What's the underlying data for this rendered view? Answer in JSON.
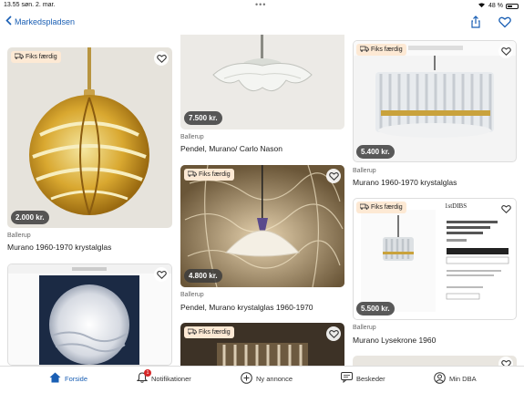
{
  "status": {
    "time": "13.55",
    "date": "søn. 2. mar.",
    "battery": "48 %"
  },
  "nav": {
    "back_label": "Markedspladsen"
  },
  "badge_label": "Fiks færdig",
  "cards": {
    "c1": {
      "price": "2.000 kr.",
      "location": "Ballerup",
      "title": "Murano 1960-1970 krystalglas"
    },
    "c2": {
      "price": "7.500 kr.",
      "location": "Ballerup",
      "title": "Pendel, Murano/ Carlo Nason"
    },
    "c3": {
      "price": "5.400 kr.",
      "location": "Ballerup",
      "title": "Murano 1960-1970 krystalglas"
    },
    "c4": {
      "price": "4.800 kr.",
      "location": "Ballerup",
      "title": "Pendel, Murano krystalglas 1960-1970"
    },
    "c5": {
      "price": "5.500 kr.",
      "location": "Ballerup",
      "title": "Murano Lysekrone 1960"
    }
  },
  "tabs": [
    {
      "label": "Forside"
    },
    {
      "label": "Notifikationer",
      "count": "1"
    },
    {
      "label": "Ny annonce"
    },
    {
      "label": "Beskeder"
    },
    {
      "label": "Min DBA"
    }
  ],
  "colors": {
    "accent": "#1a5fb4",
    "badge_bg": "#fde9d4",
    "notification": "#d62728"
  }
}
